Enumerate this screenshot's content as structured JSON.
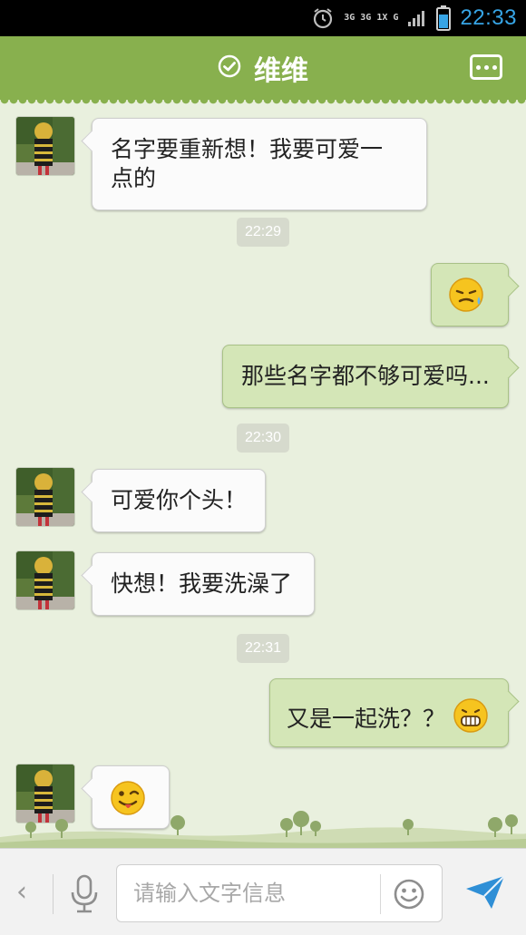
{
  "status_bar": {
    "network_top": "3G 3G 1X G",
    "time": "22:33",
    "icons": [
      "alarm-icon",
      "network-indicator-icon",
      "signal-icon",
      "battery-icon"
    ]
  },
  "header": {
    "title": "维维",
    "online_icon": "check-circle-icon",
    "more_icon": "more-icon"
  },
  "messages": [
    {
      "side": "left",
      "text_line1": "名字要重新想！我要可爱一",
      "text_line2": "点的"
    },
    {
      "timestamp": "22:29"
    },
    {
      "side": "right",
      "emoji": "sweat-smile-emoji"
    },
    {
      "side": "right",
      "text": "那些名字都不够可爱吗..."
    },
    {
      "timestamp": "22:30"
    },
    {
      "side": "left",
      "text": "可爱你个头！"
    },
    {
      "side": "left",
      "text": "快想！我要洗澡了"
    },
    {
      "timestamp": "22:31"
    },
    {
      "side": "right",
      "text": "又是一起洗？？",
      "emoji": "grin-emoji"
    },
    {
      "side": "left",
      "emoji": "wink-tongue-emoji"
    }
  ],
  "ts": {
    "t1": "22:29",
    "t2": "22:30",
    "t3": "22:31"
  },
  "input_bar": {
    "placeholder": "请输入文字信息",
    "icons": [
      "back-chevron-icon",
      "microphone-icon",
      "smiley-icon",
      "send-icon"
    ]
  },
  "colors": {
    "header_green": "#88b04e",
    "chat_bg": "#e9f0de",
    "right_bubble": "#d4e6b7",
    "left_bubble": "#fbfbfb",
    "time_blue": "#37a5e6",
    "send_blue": "#2f8fd6"
  }
}
